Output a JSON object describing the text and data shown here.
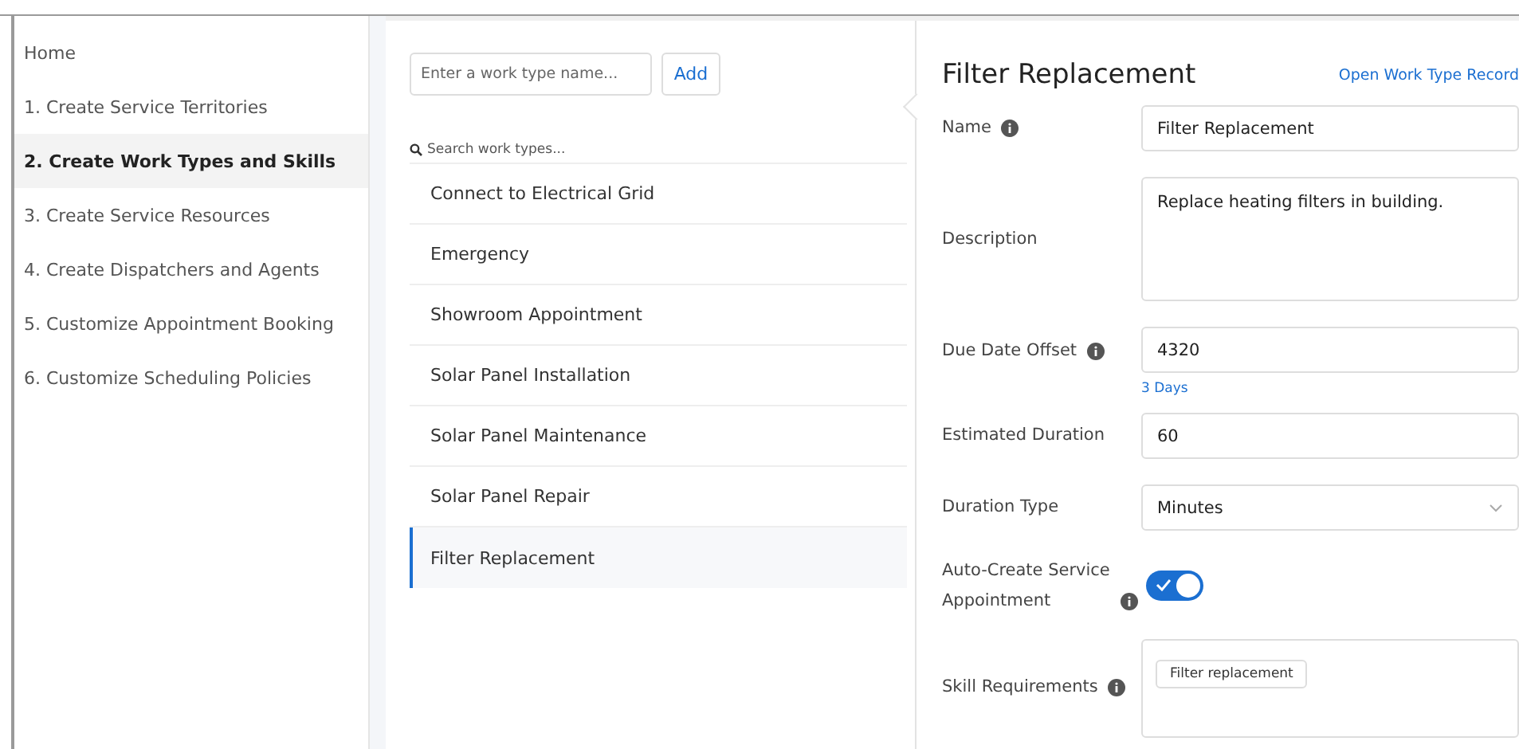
{
  "sidebar": {
    "items": [
      {
        "label": "Home",
        "selected": false
      },
      {
        "label": "1. Create Service Territories",
        "selected": false
      },
      {
        "label": "2. Create Work Types and Skills",
        "selected": true
      },
      {
        "label": "3. Create Service Resources",
        "selected": false
      },
      {
        "label": "4. Create Dispatchers and Agents",
        "selected": false
      },
      {
        "label": "5. Customize Appointment Booking",
        "selected": false
      },
      {
        "label": "6. Customize Scheduling Policies",
        "selected": false
      }
    ]
  },
  "work_types": {
    "new_name": {
      "placeholder": "Enter a work type name..."
    },
    "add_button": "Add",
    "search": {
      "placeholder": "Search work types..."
    },
    "items": [
      {
        "label": "Connect to Electrical Grid",
        "selected": false
      },
      {
        "label": "Emergency",
        "selected": false
      },
      {
        "label": "Showroom Appointment",
        "selected": false
      },
      {
        "label": "Solar Panel Installation",
        "selected": false
      },
      {
        "label": "Solar Panel Maintenance",
        "selected": false
      },
      {
        "label": "Solar Panel Repair",
        "selected": false
      },
      {
        "label": "Filter Replacement",
        "selected": true
      }
    ]
  },
  "detail": {
    "title": "Filter Replacement",
    "link": "Open Work Type Record",
    "fields": [
      {
        "kind": "text",
        "label": "Name",
        "info": true,
        "value": "Filter Replacement"
      },
      {
        "kind": "textarea",
        "label": "Description",
        "info": false,
        "value": "Replace heating filters in building."
      },
      {
        "kind": "text",
        "label": "Due Date Offset",
        "info": true,
        "value": "4320",
        "hint": "3 Days"
      },
      {
        "kind": "text",
        "label": "Estimated Duration",
        "info": false,
        "value": "60"
      },
      {
        "kind": "select",
        "label": "Duration Type",
        "info": false,
        "value": "Minutes"
      },
      {
        "kind": "toggle",
        "label": "Auto-Create Service Appointment",
        "info": true,
        "on": true
      },
      {
        "kind": "tags",
        "label": "Skill Requirements",
        "info": true,
        "tags": [
          "Filter replacement"
        ]
      }
    ]
  }
}
